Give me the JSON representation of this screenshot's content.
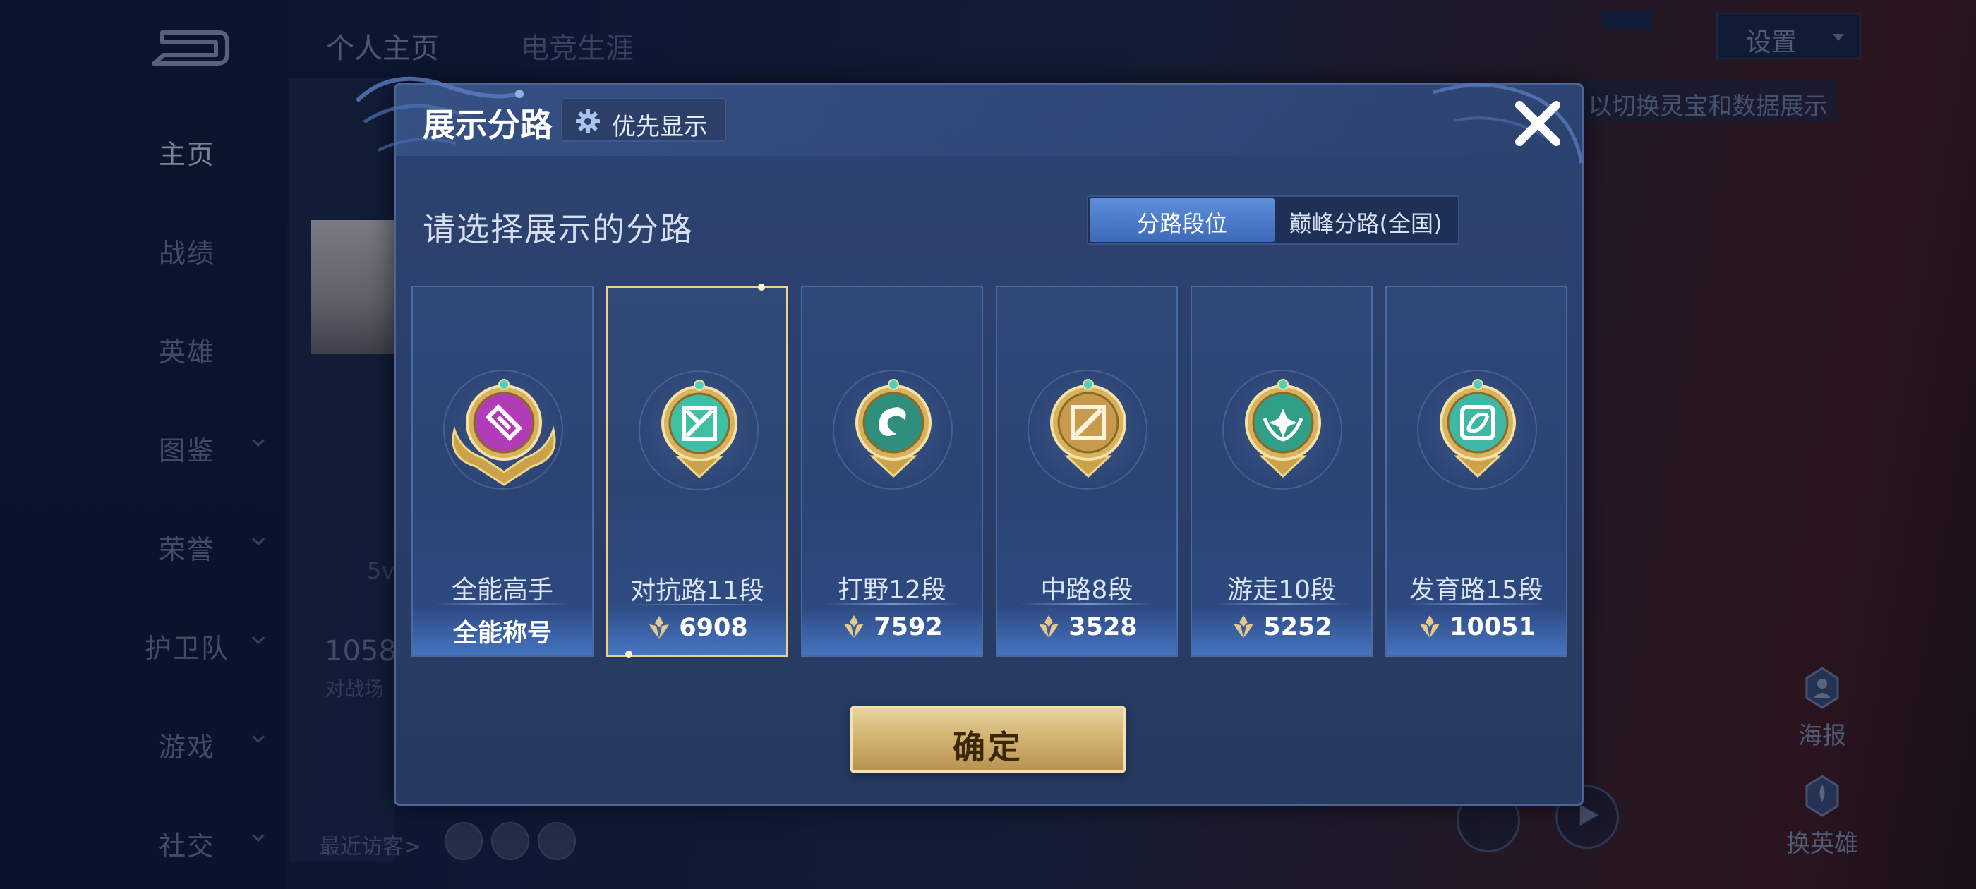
{
  "sidebar": {
    "items": [
      {
        "label": "主页",
        "active": true,
        "chevron": false
      },
      {
        "label": "战绩",
        "active": false,
        "chevron": false
      },
      {
        "label": "英雄",
        "active": false,
        "chevron": false
      },
      {
        "label": "图鉴",
        "active": false,
        "chevron": true
      },
      {
        "label": "荣誉",
        "active": false,
        "chevron": true
      },
      {
        "label": "护卫队",
        "active": false,
        "chevron": true
      },
      {
        "label": "游戏",
        "active": false,
        "chevron": true
      },
      {
        "label": "社交",
        "active": false,
        "chevron": true
      }
    ]
  },
  "header": {
    "tabs": [
      "个人主页",
      "电竞生涯"
    ],
    "settings_label": "设置",
    "hint": "以切换灵宝和数据展示"
  },
  "background": {
    "number": "1058",
    "subtext": "对战场",
    "five_v": "5v",
    "recent_visitors": "最近访客>",
    "poster_label": "海报",
    "switch_hero_label": "换英雄"
  },
  "dialog": {
    "title": "展示分路",
    "priority_button": "优先显示",
    "subtitle": "请选择展示的分路",
    "segments": [
      "分路段位",
      "巅峰分路(全国)"
    ],
    "active_segment": 0,
    "cards": [
      {
        "name": "全能高手",
        "stat": "全能称号",
        "has_points_icon": false,
        "selected": false,
        "badge": "allround-badge-icon",
        "badge_color": "#b23bb8"
      },
      {
        "name": "对抗路11段",
        "stat": "6908",
        "has_points_icon": true,
        "selected": true,
        "badge": "clash-lane-badge-icon",
        "badge_color": "#3fbfa3"
      },
      {
        "name": "打野12段",
        "stat": "7592",
        "has_points_icon": true,
        "selected": false,
        "badge": "jungle-badge-icon",
        "badge_color": "#2f8e7c"
      },
      {
        "name": "中路8段",
        "stat": "3528",
        "has_points_icon": true,
        "selected": false,
        "badge": "mid-lane-badge-icon",
        "badge_color": "#c79a4e"
      },
      {
        "name": "游走10段",
        "stat": "5252",
        "has_points_icon": true,
        "selected": false,
        "badge": "roam-badge-icon",
        "badge_color": "#2f9f86"
      },
      {
        "name": "发育路15段",
        "stat": "10051",
        "has_points_icon": true,
        "selected": false,
        "badge": "farm-lane-badge-icon",
        "badge_color": "#3fb7a5"
      }
    ],
    "confirm_label": "确定"
  },
  "colors": {
    "gold": "#f0cf8a",
    "panel": "#2d4371",
    "accent_blue": "#4e82d0"
  }
}
